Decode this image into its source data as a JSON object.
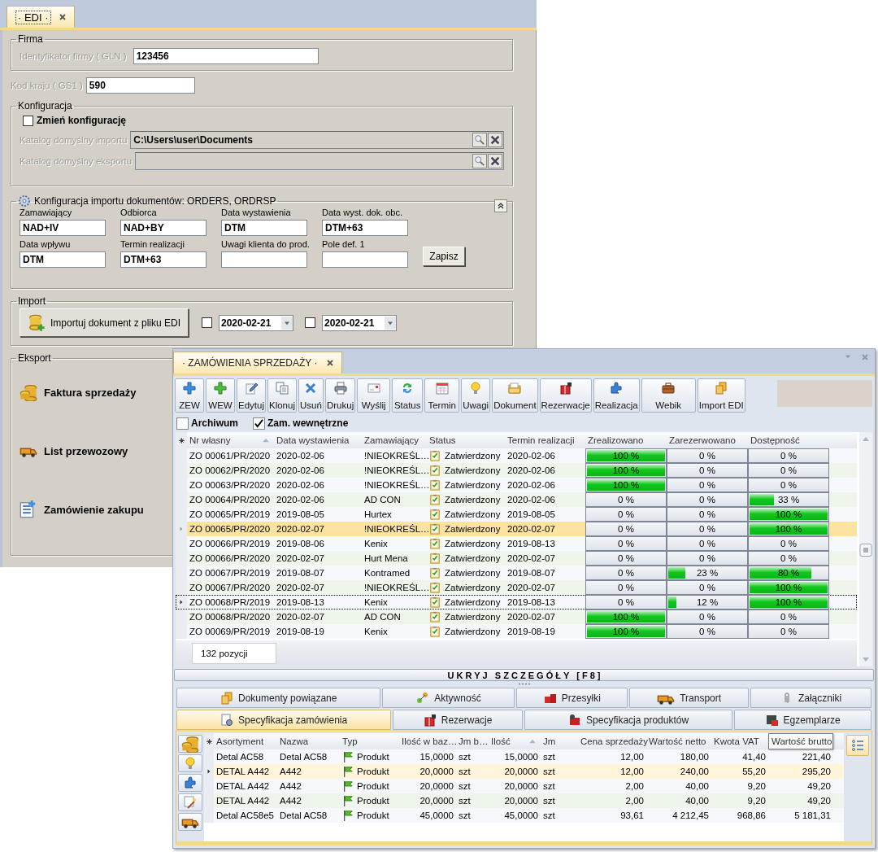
{
  "edi": {
    "tab": {
      "label": "· EDI ·",
      "selected": true
    },
    "firma": {
      "title": "Firma",
      "label": "Identyfikator firmy ( GLN )",
      "value": "123456"
    },
    "country_code": {
      "label": "Kod kraju ( GS1 )",
      "value": "590"
    },
    "config": {
      "title": "Konfiguracja",
      "change": {
        "label": "Zmień konfigurację",
        "checked": false
      },
      "dirs": [
        {
          "label": "Katalog domyślny importu",
          "value": "C:\\Users\\user\\Documents"
        },
        {
          "label": "Katalog domyślny eksportu"
        }
      ]
    },
    "import_config": {
      "title": "Konfiguracja importu dokumentów: ORDERS, ORDRSP",
      "fields": [
        {
          "label": "Zamawiający",
          "value": "NAD+IV"
        },
        {
          "label": "Odbiorca",
          "value": "NAD+BY"
        },
        {
          "label": "Data wystawienia",
          "value": "DTM"
        },
        {
          "label": "Data wyst. dok. obc.",
          "value": "DTM+63"
        },
        {
          "label": "Data wpływu",
          "value": "DTM"
        },
        {
          "label": "Termin realizacji",
          "value": "DTM+63"
        },
        {
          "label": "Uwagi klienta do prod."
        },
        {
          "label": "Pole def. 1"
        }
      ],
      "save_button": "Zapisz"
    },
    "import": {
      "title": "Import",
      "button": "Importuj dokument z pliku EDI",
      "dates": [
        {
          "checked": false,
          "value": "2020-02-21"
        },
        {
          "checked": false,
          "value": "2020-02-21"
        }
      ]
    },
    "export": {
      "title": "Eksport",
      "items": [
        "Faktura sprzedaży",
        "List przewozowy",
        "Zamówienie zakupu"
      ]
    }
  },
  "orders": {
    "tab": {
      "label": "· ZAMÓWIENIA SPRZEDAŻY ·",
      "selected": true
    },
    "toolbar": [
      "ZEW",
      "WEW",
      "Edytuj",
      "Klonuj",
      "Usuń",
      "Drukuj",
      "Wyślij",
      "Status",
      "Termin",
      "Uwagi",
      "Dokument",
      "Rezerwacje",
      "Realizacja",
      "Webik",
      "Import EDI"
    ],
    "filters": [
      {
        "label": "Archiwum",
        "checked": false
      },
      {
        "label": "Zam. wewnętrzne",
        "checked": true
      }
    ],
    "table": {
      "columns": [
        "Nr własny",
        "Data wystawienia",
        "Zamawiający",
        "Status",
        "Termin realizacji",
        "Zrealizowano",
        "Zarezerwowano",
        "Dostępność"
      ],
      "rows": [
        {
          "nr": "ZO 00061/PR/2020",
          "date": "2020-02-06",
          "customer": "!NIEOKREŚL…",
          "status": "Zatwierdzony",
          "due": "2020-02-06",
          "realized": {
            "level": 1,
            "reading": "100 %"
          },
          "reserved": {
            "level": 0,
            "reading": "0 %"
          },
          "availability": {
            "level": 0,
            "reading": "0 %"
          },
          "selected": false,
          "focused": false
        },
        {
          "nr": "ZO 00062/PR/2020",
          "date": "2020-02-06",
          "customer": "!NIEOKREŚL…",
          "status": "Zatwierdzony",
          "due": "2020-02-06",
          "realized": {
            "level": 1,
            "reading": "100 %"
          },
          "reserved": {
            "level": 0,
            "reading": "0 %"
          },
          "availability": {
            "level": 0,
            "reading": "0 %"
          },
          "selected": false,
          "focused": false
        },
        {
          "nr": "ZO 00063/PR/2020",
          "date": "2020-02-06",
          "customer": "!NIEOKREŚL…",
          "status": "Zatwierdzony",
          "due": "2020-02-06",
          "realized": {
            "level": 1,
            "reading": "100 %"
          },
          "reserved": {
            "level": 0,
            "reading": "0 %"
          },
          "availability": {
            "level": 0,
            "reading": "0 %"
          },
          "selected": false,
          "focused": false
        },
        {
          "nr": "ZO 00064/PR/2020",
          "date": "2020-02-06",
          "customer": "AD CON",
          "status": "Zatwierdzony",
          "due": "2020-02-06",
          "realized": {
            "level": 0,
            "reading": "0 %"
          },
          "reserved": {
            "level": 0,
            "reading": "0 %"
          },
          "availability": {
            "level": 0.33,
            "reading": "33 %"
          },
          "selected": false,
          "focused": false
        },
        {
          "nr": "ZO 00065/PR/2019",
          "date": "2019-08-05",
          "customer": "Hurtex",
          "status": "Zatwierdzony",
          "due": "2019-08-05",
          "realized": {
            "level": 0,
            "reading": "0 %"
          },
          "reserved": {
            "level": 0,
            "reading": "0 %"
          },
          "availability": {
            "level": 1,
            "reading": "100 %"
          },
          "selected": false,
          "focused": false
        },
        {
          "nr": "ZO 00065/PR/2020",
          "date": "2020-02-07",
          "customer": "!NIEOKREŚL…",
          "status": "Zatwierdzony",
          "due": "2020-02-07",
          "realized": {
            "level": 0,
            "reading": "0 %"
          },
          "reserved": {
            "level": 0,
            "reading": "0 %"
          },
          "availability": {
            "level": 1,
            "reading": "100 %"
          },
          "selected": true,
          "focused": false
        },
        {
          "nr": "ZO 00066/PR/2019",
          "date": "2019-08-06",
          "customer": "Kenix",
          "status": "Zatwierdzony",
          "due": "2019-08-13",
          "realized": {
            "level": 0,
            "reading": "0 %"
          },
          "reserved": {
            "level": 0,
            "reading": "0 %"
          },
          "availability": {
            "level": 0,
            "reading": "0 %"
          },
          "selected": false,
          "focused": false
        },
        {
          "nr": "ZO 00066/PR/2020",
          "date": "2020-02-07",
          "customer": "Hurt Mena",
          "status": "Zatwierdzony",
          "due": "2020-02-07",
          "realized": {
            "level": 0,
            "reading": "0 %"
          },
          "reserved": {
            "level": 0,
            "reading": "0 %"
          },
          "availability": {
            "level": 0,
            "reading": "0 %"
          },
          "selected": false,
          "focused": false
        },
        {
          "nr": "ZO 00067/PR/2019",
          "date": "2019-08-07",
          "customer": "Kontramed",
          "status": "Zatwierdzony",
          "due": "2019-08-07",
          "realized": {
            "level": 0,
            "reading": "0 %"
          },
          "reserved": {
            "level": 0.23,
            "reading": "23 %"
          },
          "availability": {
            "level": 0.8,
            "reading": "80 %"
          },
          "selected": false,
          "focused": false
        },
        {
          "nr": "ZO 00067/PR/2020",
          "date": "2020-02-07",
          "customer": "!NIEOKREŚL…",
          "status": "Zatwierdzony",
          "due": "2020-02-07",
          "realized": {
            "level": 0,
            "reading": "0 %"
          },
          "reserved": {
            "level": 0,
            "reading": "0 %"
          },
          "availability": {
            "level": 1,
            "reading": "100 %"
          },
          "selected": false,
          "focused": false
        },
        {
          "nr": "ZO 00068/PR/2019",
          "date": "2019-08-13",
          "customer": "Kenix",
          "status": "Zatwierdzony",
          "due": "2019-08-13",
          "realized": {
            "level": 0,
            "reading": "0 %"
          },
          "reserved": {
            "level": 0.12,
            "reading": "12 %"
          },
          "availability": {
            "level": 1,
            "reading": "100 %"
          },
          "selected": false,
          "focused": true
        },
        {
          "nr": "ZO 00068/PR/2020",
          "date": "2020-02-07",
          "customer": "AD CON",
          "status": "Zatwierdzony",
          "due": "2020-02-07",
          "realized": {
            "level": 1,
            "reading": "100 %"
          },
          "reserved": {
            "level": 0,
            "reading": "0 %"
          },
          "availability": {
            "level": 0,
            "reading": "0 %"
          },
          "selected": false,
          "focused": false
        },
        {
          "nr": "ZO 00069/PR/2019",
          "date": "2019-08-19",
          "customer": "Kenix",
          "status": "Zatwierdzony",
          "due": "2019-08-19",
          "realized": {
            "level": 1,
            "reading": "100 %"
          },
          "reserved": {
            "level": 0,
            "reading": "0 %"
          },
          "availability": {
            "level": 0,
            "reading": "0 %"
          },
          "selected": false,
          "focused": false
        }
      ],
      "count": "132 pozycji"
    },
    "hide_details": "U K R Y J   S Z C Z E G Ó Ł Y   [ F 8 ]",
    "detail_tabs": [
      [
        {
          "label": "Dokumenty powiązane",
          "selected": false
        },
        {
          "label": "Aktywność",
          "selected": false
        },
        {
          "label": "Przesyłki",
          "selected": false
        },
        {
          "label": "Transport",
          "selected": false
        },
        {
          "label": "Załączniki",
          "selected": false
        }
      ],
      [
        {
          "label": "Specyfikacja zamówienia",
          "selected": true
        },
        {
          "label": "Rezerwacje",
          "selected": false
        },
        {
          "label": "Specyfikacja produktów",
          "selected": false
        },
        {
          "label": "Egzemplarze",
          "selected": false
        }
      ]
    ],
    "detail_table": {
      "columns": [
        "Asortyment",
        "Nazwa",
        "Typ",
        "Ilość w baz…",
        "Jm b…",
        "Ilość",
        "Jm",
        "Cena sprzedaży",
        "Wartość netto",
        "Kwota VAT",
        "Wartość brutto"
      ],
      "rows": [
        {
          "cells": [
            "Detal AC58",
            "Detal AC58",
            "Produkt",
            "15,0000",
            "szt",
            "15,0000",
            "szt",
            "12,00",
            "180,00",
            "41,40",
            "221,40"
          ],
          "selected": false
        },
        {
          "cells": [
            "DETAL A442",
            "A442",
            "Produkt",
            "20,0000",
            "szt",
            "20,0000",
            "szt",
            "12,00",
            "240,00",
            "55,20",
            "295,20"
          ],
          "selected": true
        },
        {
          "cells": [
            "DETAL A442",
            "A442",
            "Produkt",
            "20,0000",
            "szt",
            "20,0000",
            "szt",
            "2,00",
            "40,00",
            "9,20",
            "49,20"
          ],
          "selected": false
        },
        {
          "cells": [
            "DETAL A442",
            "A442",
            "Produkt",
            "20,0000",
            "szt",
            "20,0000",
            "szt",
            "2,00",
            "40,00",
            "9,20",
            "49,20"
          ],
          "selected": false
        },
        {
          "cells": [
            "Detal AC58e5",
            "Detal AC58",
            "Produkt",
            "45,0000",
            "szt",
            "45,0000",
            "szt",
            "93,61",
            "4 212,45",
            "968,86",
            "5 181,31"
          ],
          "selected": false
        }
      ]
    }
  }
}
